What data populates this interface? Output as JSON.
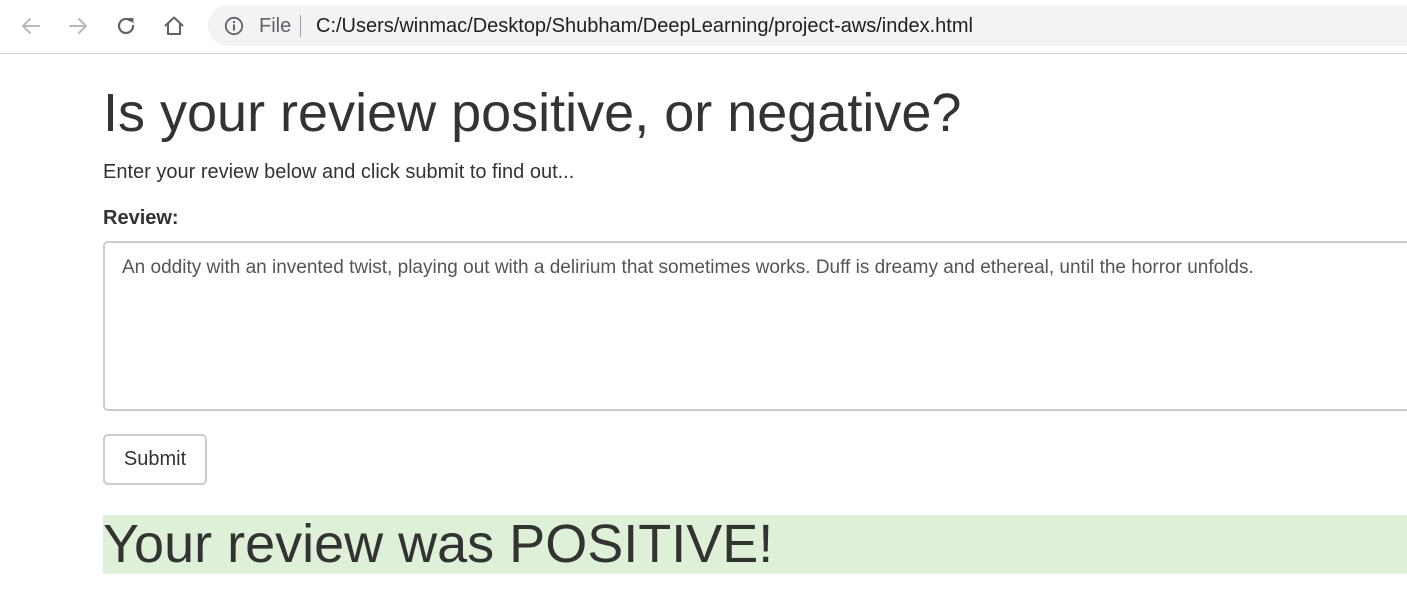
{
  "browser": {
    "scheme_label": "File",
    "url": "C:/Users/winmac/Desktop/Shubham/DeepLearning/project-aws/index.html",
    "icons": {
      "back": "arrow-left-icon",
      "forward": "arrow-right-icon",
      "reload": "reload-icon",
      "home": "home-icon",
      "info": "info-icon"
    }
  },
  "page": {
    "title": "Is your review positive, or negative?",
    "intro": "Enter your review below and click submit to find out...",
    "form": {
      "review_label": "Review:",
      "review_value": "An oddity with an invented twist, playing out with a delirium that sometimes works. Duff is dreamy and ethereal, until the horror unfolds.",
      "submit_label": "Submit"
    },
    "result": {
      "text": "Your review was POSITIVE!",
      "background_color": "#dff0d8"
    }
  }
}
